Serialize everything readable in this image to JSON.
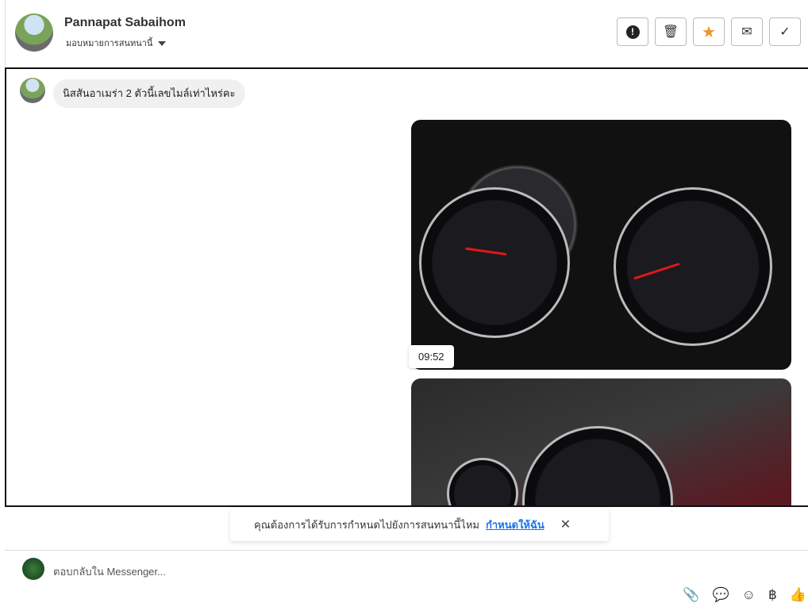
{
  "header": {
    "name": "Pannapat Sabaihom",
    "assign_label": "มอบหมายการสนทนานี้"
  },
  "actions": [
    {
      "name": "spam-button",
      "glyph": "!"
    },
    {
      "name": "delete-button",
      "glyph": "🗑"
    },
    {
      "name": "star-button",
      "glyph": "★"
    },
    {
      "name": "mark-unread-button",
      "glyph": "✉"
    },
    {
      "name": "done-button",
      "glyph": "✓"
    }
  ],
  "messages": {
    "incoming": "นิสสันอาเมร่า 2 ตัวนี้เลขไมล์เท่าไหร่คะ",
    "time": "09:52"
  },
  "notice": {
    "text": "คุณต้องการได้รับการกำหนดไปยังการสนทนานี้ไหม",
    "link": "กำหนดให้ฉัน",
    "close": "✕"
  },
  "composer": {
    "placeholder": "ตอบกลับใน Messenger..."
  },
  "tools": [
    "📎",
    "💬",
    "☺",
    "฿",
    "👍"
  ],
  "colors": {
    "star": "#f0932b",
    "link": "#1a73e8"
  }
}
